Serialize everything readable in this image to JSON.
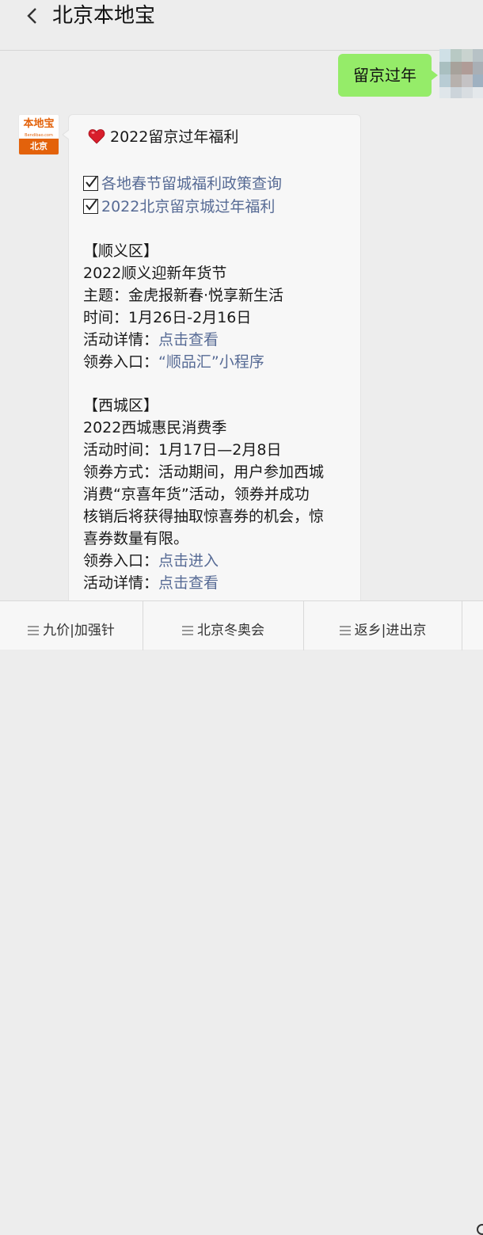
{
  "header": {
    "title": "北京本地宝",
    "back_icon": "chevron-left-icon"
  },
  "user_message": {
    "text": "留京过年",
    "bubble_color": "#95ec69"
  },
  "bot": {
    "avatar": {
      "logo_text": "本地宝",
      "site_text": "Bendibao.com",
      "city_text": "北京",
      "brand_color": "#e3620b"
    },
    "message": {
      "title": "2022留京过年福利",
      "check_links": [
        "各地春节留城福利政策查询",
        "2022北京留京城过年福利"
      ],
      "shunyi": {
        "heading": "【顺义区】",
        "event": "2022顺义迎新年货节",
        "theme": "主题：金虎报新春·悦享新生活",
        "time": "时间：1月26日-2月16日",
        "details_label": "活动详情：",
        "details_link": "点击查看",
        "coupon_label": "领券入口：",
        "coupon_link": "“顺品汇”小程序"
      },
      "xicheng": {
        "heading": "【西城区】",
        "event": "2022西城惠民消费季",
        "time": "活动时间：1月17日—2月8日",
        "method_lines": [
          "领券方式：活动期间，用户参加西城",
          "消费“京喜年货”活动，领券并成功",
          "核销后将获得抽取惊喜券的机会，惊",
          "喜券数量有限。"
        ],
        "coupon_label": "领券入口：",
        "coupon_link": "点击进入",
        "details_label": "活动详情：",
        "details_link": "点击查看"
      }
    }
  },
  "bottom_menu": [
    {
      "label": "九价|加强针",
      "icon": "menu-icon"
    },
    {
      "label": "北京冬奥会",
      "icon": "menu-icon"
    },
    {
      "label": "返乡|进出京",
      "icon": "menu-icon"
    }
  ],
  "colors": {
    "background": "#ededed",
    "link": "#576b95",
    "bubble": "#f7f7f7"
  }
}
